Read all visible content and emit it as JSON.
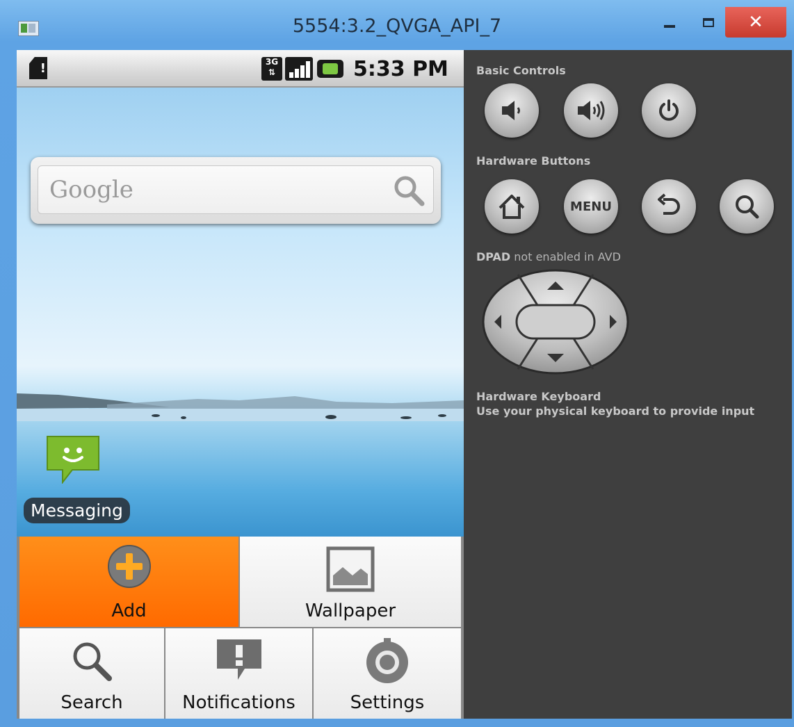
{
  "window": {
    "title": "5554:3.2_QVGA_API_7"
  },
  "statusbar": {
    "network": "3G",
    "time": "5:33 PM"
  },
  "home": {
    "search_placeholder": "Google",
    "app_label": "Messaging"
  },
  "menu": {
    "items": [
      {
        "label": "Add",
        "icon": "add-icon",
        "selected": true
      },
      {
        "label": "Wallpaper",
        "icon": "wallpaper-icon",
        "selected": false
      },
      {
        "label": "Search",
        "icon": "search-icon",
        "selected": false
      },
      {
        "label": "Notifications",
        "icon": "notifications-icon",
        "selected": false
      },
      {
        "label": "Settings",
        "icon": "settings-icon",
        "selected": false
      }
    ]
  },
  "panel": {
    "basic_controls": "Basic Controls",
    "hardware_buttons": "Hardware Buttons",
    "menu_button": "MENU",
    "dpad_bold": "DPAD",
    "dpad_rest": " not enabled in AVD",
    "keyboard_title": "Hardware Keyboard",
    "keyboard_note": "Use your physical keyboard to provide input"
  },
  "colors": {
    "accent_selected": "#ff7a00",
    "panel_bg": "#3f3f3f",
    "close_red": "#d9473b"
  }
}
